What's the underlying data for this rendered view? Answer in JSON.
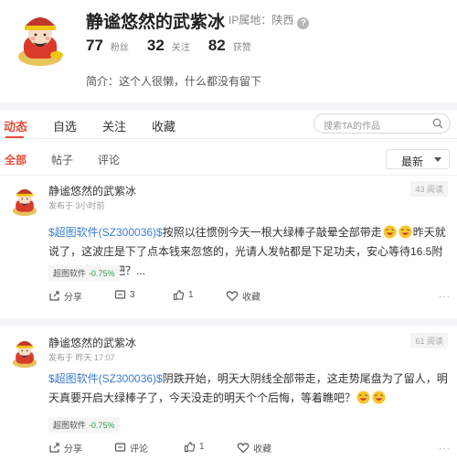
{
  "profile": {
    "name": "静谧悠然的武紫冰",
    "ip_label": "IP属地：陕西",
    "help_glyph": "?",
    "stats": [
      {
        "value": "77",
        "label": "粉丝"
      },
      {
        "value": "32",
        "label": "关注"
      },
      {
        "value": "82",
        "label": "获赞"
      }
    ],
    "bio": "简介：这个人很懒，什么都没有留下"
  },
  "main_tabs": [
    {
      "label": "动态",
      "active": true
    },
    {
      "label": "自选",
      "active": false
    },
    {
      "label": "关注",
      "active": false
    },
    {
      "label": "收藏",
      "active": false
    }
  ],
  "search": {
    "placeholder": "搜索TA的作品"
  },
  "sub_tabs": [
    {
      "label": "全部",
      "active": true
    },
    {
      "label": "帖子",
      "active": false
    },
    {
      "label": "评论",
      "active": false
    }
  ],
  "sort": {
    "selected": "最新"
  },
  "posts": [
    {
      "author": "静谧悠然的武紫冰",
      "time": "发布于 3小时前",
      "views": "43 阅读",
      "stock_tag": "$超图软件(SZ300036)$",
      "text_a": "按照以往惯例今天一根大绿棒子敲晕全部带走",
      "text_b": "昨天就说了，这波庄是下了点本钱来忽悠的，光请人发帖都是下足功夫，安心等待16.5附近看割肉情况吧？...",
      "chip_name": "超图软件",
      "chip_change": "-0.75%",
      "share_label": "分享",
      "comment_label": "3",
      "like_label": "1",
      "fav_label": "收藏",
      "more_label": "···"
    },
    {
      "author": "静谧悠然的武紫冰",
      "time": "发布于 昨天 17:07",
      "views": "61 阅读",
      "stock_tag": "$超图软件(SZ300036)$",
      "text_a": "阴跌开始，明天大阴线全部带走，这走势尾盘为了留人，明天真要开启大绿棒子了，今天没走的明天个个后悔，等着瞧吧？",
      "text_b": "",
      "chip_name": "超图软件",
      "chip_change": "-0.75%",
      "share_label": "分享",
      "comment_label": "评论",
      "like_label": "1",
      "fav_label": "收藏",
      "more_label": "···"
    }
  ],
  "colors": {
    "accent": "#e74c3c",
    "link": "#3a7bd5",
    "down": "#2e9e4f"
  }
}
